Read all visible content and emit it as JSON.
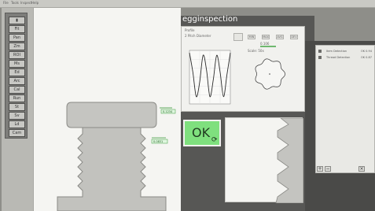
{
  "menubar": {
    "items": [
      "File",
      "Tools",
      "Inspect",
      "Help"
    ]
  },
  "app": {
    "title": "egginspection"
  },
  "toolbar": {
    "buttons": [
      {
        "name": "tool-select",
        "label": "▮"
      },
      {
        "name": "tool-fit",
        "label": "Fit"
      },
      {
        "name": "tool-pan",
        "label": "Pan"
      },
      {
        "name": "tool-zoom",
        "label": "Zm"
      },
      {
        "name": "tool-roi",
        "label": "ROI"
      },
      {
        "name": "tool-measure",
        "label": "Ms"
      },
      {
        "name": "tool-edge",
        "label": "Ed"
      },
      {
        "name": "tool-arc",
        "label": "Arc"
      },
      {
        "name": "tool-cal",
        "label": "Cal"
      },
      {
        "name": "tool-run",
        "label": "Run"
      },
      {
        "name": "tool-stop",
        "label": "St"
      },
      {
        "name": "tool-save",
        "label": "Sv"
      },
      {
        "name": "tool-load",
        "label": "Ld"
      },
      {
        "name": "tool-camera",
        "label": "Cam"
      }
    ]
  },
  "image_view": {
    "measure_top": "0.1234",
    "measure_mid": "0.0831"
  },
  "chart_window": {
    "title": "Profile",
    "subtitle": "2 Pitch Diameter",
    "btn_min": "MIN",
    "btn_max": "MAX",
    "btn_avg": "AVG",
    "btn_dev": "DEV",
    "value_line": "0.106",
    "scale_label": "Scale: 50x"
  },
  "chart_data": {
    "type": "line",
    "title": "",
    "xlabel": "",
    "ylabel": "",
    "x": [
      0,
      30,
      60,
      90,
      120,
      150,
      180,
      210,
      240,
      270,
      300,
      330,
      360
    ],
    "series": [
      {
        "values": [
          1.0,
          0.2,
          -0.8,
          -0.2,
          0.9,
          0.3,
          -0.8,
          -0.1,
          0.9,
          0.2,
          -0.8,
          0.1,
          1.0
        ]
      }
    ]
  },
  "result": {
    "label": "OK",
    "color": "#7fe07e"
  },
  "list_window": {
    "rows": [
      {
        "name": "Item Detection",
        "value": "OK 0.94"
      },
      {
        "name": "Thread Detection",
        "value": "OK 0.87"
      }
    ],
    "add_label": "+",
    "remove_label": "−",
    "close_label": "×"
  }
}
